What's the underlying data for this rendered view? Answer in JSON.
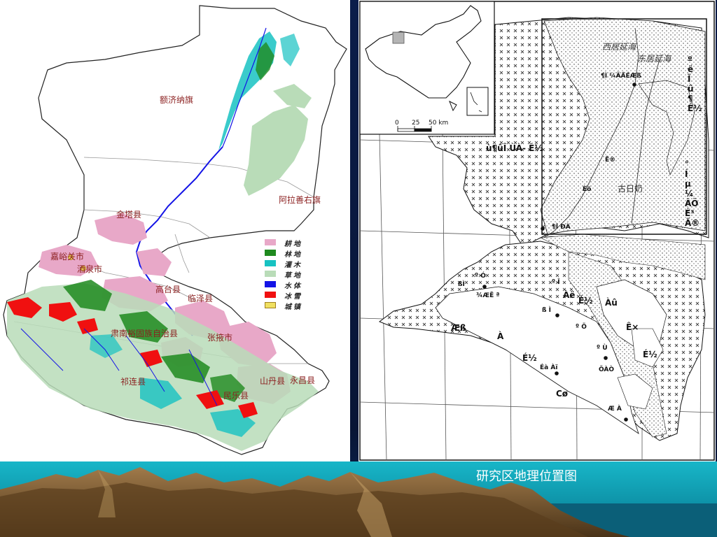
{
  "caption": "研究区地理位置图",
  "left_map": {
    "places": [
      {
        "key": "ejina",
        "label": "额济纳旗"
      },
      {
        "key": "alashan",
        "label": "阿拉善右旗"
      },
      {
        "key": "jinta",
        "label": "金塔县"
      },
      {
        "key": "jiayuguan",
        "label": "嘉峪关市"
      },
      {
        "key": "jiuquan",
        "label": "酒泉市"
      },
      {
        "key": "gaotai",
        "label": "高台县"
      },
      {
        "key": "linze",
        "label": "临泽县"
      },
      {
        "key": "sunan",
        "label": "肃南裕固族自治县"
      },
      {
        "key": "zhangye",
        "label": "张掖市"
      },
      {
        "key": "qilian",
        "label": "祁连县"
      },
      {
        "key": "shandan",
        "label": "山丹县"
      },
      {
        "key": "yongchang",
        "label": "永昌县"
      },
      {
        "key": "minle",
        "label": "民乐县"
      }
    ],
    "legend": [
      {
        "label": "耕地",
        "color": "#e8a8c8"
      },
      {
        "label": "林地",
        "color": "#1f8a1f"
      },
      {
        "label": "灌木",
        "color": "#17c2c2"
      },
      {
        "label": "草地",
        "color": "#b9dcb8"
      },
      {
        "label": "水体",
        "color": "#1414e6"
      },
      {
        "label": "冰雪",
        "color": "#f01010"
      },
      {
        "label": "城镇",
        "color": "#f0e060"
      }
    ]
  },
  "right_map": {
    "labels": {
      "xijuyan": "西居延海",
      "dongjuyan": "东居延海",
      "gurinai": "古日奶",
      "garbled_1": "ù¶ûÎ ÙÀ- É½",
      "garbled_2": "¶Ì ¼ÃÄÉÆß",
      "garbled_3": "Ë®",
      "garbled_4": "Èõ",
      "garbled_5": "¶Ì ÐÀ",
      "garbled_6": "Æß",
      "garbled_7": "À",
      "garbled_8": "Àë",
      "garbled_9": "É½",
      "garbled_10": "Àû",
      "garbled_11": "Ê×",
      "garbled_12": "É½",
      "garbled_13": "Cø",
      "garbled_14": "Éà Àï",
      "garbled_15": "ÕÀÒ",
      "garbled_16": "Æ À",
      "garbled_17": "ß Ì",
      "garbled_18": "¾ÆË ª",
      "garbled_19": "º Ó",
      "garbled_20": "º Î",
      "garbled_21": "ßÌ",
      "garbled_22": "º Ö",
      "garbled_23": "º Ù",
      "side_right_top": [
        "º",
        "ë",
        "Ï",
        "û",
        "¶",
        "û",
        "É½"
      ],
      "side_right_mid": [
        "°",
        "Í",
        "µ",
        "¤",
        "¼",
        "ÂÖ",
        "É³",
        "Ä®"
      ]
    },
    "scale": {
      "ticks": [
        "0",
        "25",
        "50 km"
      ]
    }
  }
}
